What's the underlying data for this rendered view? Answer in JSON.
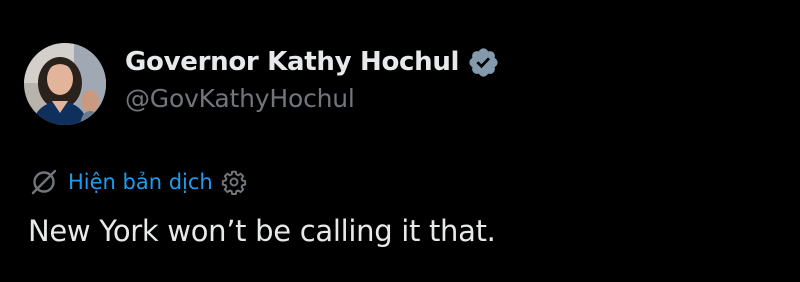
{
  "author": {
    "display_name": "Governor Kathy Hochul",
    "handle": "@GovKathyHochul",
    "verified_icon": "verified-badge-icon",
    "avatar_icon": "profile-avatar"
  },
  "translation": {
    "icon": "translate-off-icon",
    "label": "Hiện bản dịch",
    "settings_icon": "gear-icon"
  },
  "tweet": {
    "text": "New York won’t be calling it that."
  },
  "colors": {
    "background": "#000000",
    "primary_text": "#e7e9ea",
    "secondary_text": "#71767b",
    "link": "#1d9bf0",
    "verified_badge": "#829aab"
  }
}
